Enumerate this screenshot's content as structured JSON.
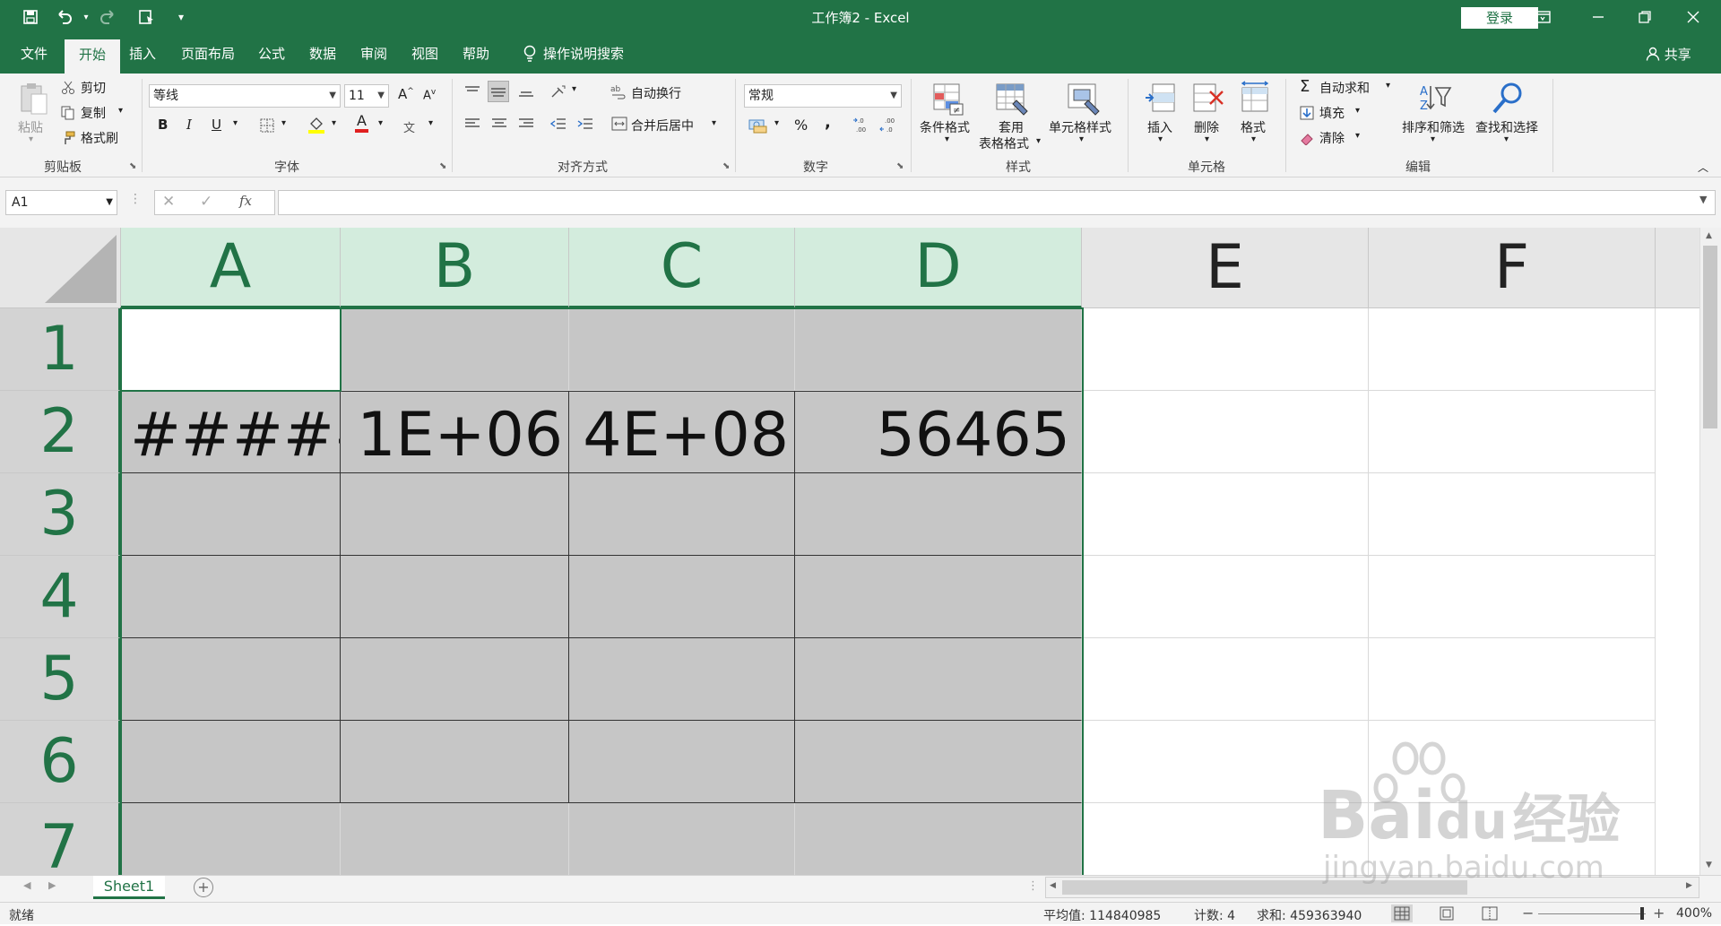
{
  "titlebar": {
    "title": "工作簿2  -  Excel",
    "login_label": "登录",
    "icons": [
      "save-icon",
      "undo-icon",
      "redo-icon",
      "touch-mode-icon",
      "customize-qat-icon"
    ]
  },
  "tabs": [
    {
      "label": "文件"
    },
    {
      "label": "开始"
    },
    {
      "label": "插入"
    },
    {
      "label": "页面布局"
    },
    {
      "label": "公式"
    },
    {
      "label": "数据"
    },
    {
      "label": "审阅"
    },
    {
      "label": "视图"
    },
    {
      "label": "帮助"
    },
    {
      "label": "操作说明搜索"
    }
  ],
  "share_label": "共享",
  "ribbon": {
    "clipboard": {
      "paste": "粘贴",
      "cut": "剪切",
      "copy": "复制",
      "format_painter": "格式刷",
      "group": "剪贴板"
    },
    "font": {
      "name": "等线",
      "size": "11",
      "bold": "B",
      "italic": "I",
      "underline": "U",
      "grow": "A",
      "shrink": "A",
      "font_color_glyph": "A",
      "phonetic": "文",
      "group": "字体"
    },
    "alignment": {
      "wrap": "自动换行",
      "merge": "合并后居中",
      "group": "对齐方式"
    },
    "number": {
      "format": "常规",
      "percent": "%",
      "comma": ",",
      "group": "数字"
    },
    "styles": {
      "conditional": "条件格式",
      "table_line1": "套用",
      "table_line2": "表格格式",
      "cell_styles": "单元格样式",
      "group": "样式"
    },
    "cells": {
      "insert": "插入",
      "delete": "删除",
      "format": "格式",
      "group": "单元格"
    },
    "editing": {
      "autosum": "自动求和",
      "fill": "填充",
      "clear": "清除",
      "sort": "排序和筛选",
      "find": "查找和选择",
      "group": "编辑"
    }
  },
  "formula_bar": {
    "name_box": "A1",
    "formula": "",
    "fx": "fx"
  },
  "grid": {
    "columns": [
      "A",
      "B",
      "C",
      "D",
      "E",
      "F"
    ],
    "rows": [
      "1",
      "2",
      "3",
      "4",
      "5",
      "6",
      "7"
    ],
    "row2": {
      "A": "######",
      "B": "1E+06",
      "C": "4E+08",
      "D": "56465"
    }
  },
  "sheet_tab": "Sheet1",
  "status": {
    "ready": "就绪",
    "average": "平均值: 114840985",
    "count": "计数: 4",
    "sum": "求和: 459363940",
    "zoom": "400%"
  },
  "watermark": {
    "brand": "Bai",
    "brand2": "du",
    "cn": "经验",
    "url": "jingyan.baidu.com"
  }
}
